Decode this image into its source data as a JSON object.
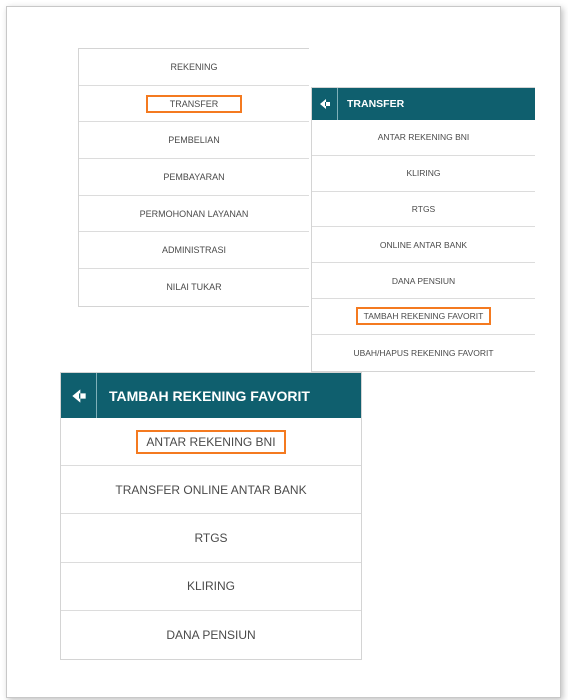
{
  "menu_main": {
    "items": [
      "REKENING",
      "TRANSFER",
      "PEMBELIAN",
      "PEMBAYARAN",
      "PERMOHONAN LAYANAN",
      "ADMINISTRASI",
      "NILAI TUKAR"
    ]
  },
  "menu_transfer": {
    "title": "TRANSFER",
    "items": [
      "ANTAR REKENING BNI",
      "KLIRING",
      "RTGS",
      "ONLINE ANTAR BANK",
      "DANA PENSIUN",
      "TAMBAH REKENING FAVORIT",
      "UBAH/HAPUS REKENING FAVORIT"
    ]
  },
  "menu_tambah": {
    "title": "TAMBAH REKENING FAVORIT",
    "items": [
      "ANTAR REKENING BNI",
      "TRANSFER ONLINE ANTAR BANK",
      "RTGS",
      "KLIRING",
      "DANA PENSIUN"
    ]
  },
  "colors": {
    "header_bg": "#0f5f6e",
    "highlight": "#f47a20"
  },
  "icons": {
    "back": "back-arrow-icon"
  }
}
